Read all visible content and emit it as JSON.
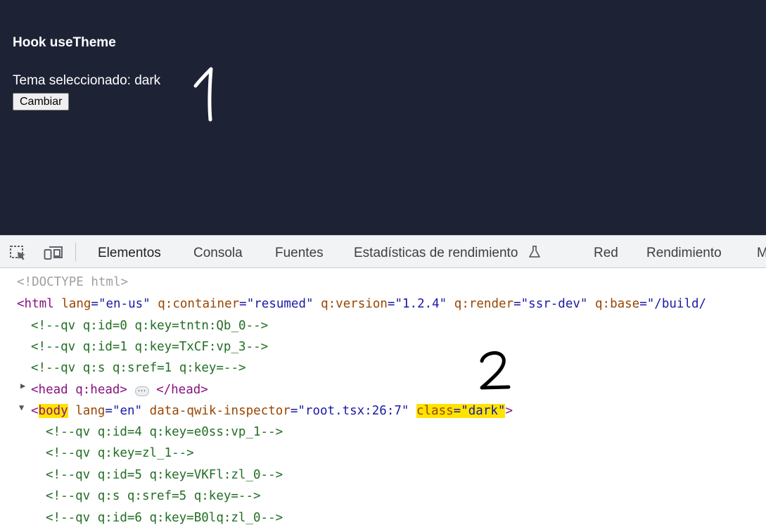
{
  "preview": {
    "heading": "Hook useTheme",
    "theme_line": "Tema seleccionado: dark",
    "button_label": "Cambiar"
  },
  "annotations": {
    "first": "1",
    "second": "2"
  },
  "toolbar": {
    "tabs": [
      {
        "label": "Elementos",
        "active": true
      },
      {
        "label": "Consola"
      },
      {
        "label": "Fuentes"
      },
      {
        "label": "Estadísticas de rendimiento",
        "icon": "flask-icon"
      },
      {
        "label": "Red"
      },
      {
        "label": "Rendimiento"
      },
      {
        "label": "M"
      }
    ],
    "icons": [
      "element-picker-icon",
      "device-toolbar-icon"
    ],
    "accent_color": "#1a73e8"
  },
  "elements_panel": {
    "doctype": "<!DOCTYPE html>",
    "html_open": {
      "tag": "html",
      "attrs": [
        {
          "name": "lang",
          "value": "\"en-us\""
        },
        {
          "name": "q:container",
          "value": "\"resumed\""
        },
        {
          "name": "q:version",
          "value": "\"1.2.4\""
        },
        {
          "name": "q:render",
          "value": "\"ssr-dev\""
        },
        {
          "name": "q:base",
          "value": "\"/build/"
        }
      ]
    },
    "html_comments": [
      "<!--qv q:id=0 q:key=tntn:Qb_0-->",
      "<!--qv q:id=1 q:key=TxCF:vp_3-->",
      "<!--qv q:s q:sref=1 q:key=-->"
    ],
    "head": {
      "open": "<head q:head>",
      "close": "</head>"
    },
    "body_open": {
      "tag": "body",
      "attrs": [
        {
          "name": "lang",
          "value": "\"en\""
        },
        {
          "name": "data-qwik-inspector",
          "value": "\"root.tsx:26:7\""
        }
      ],
      "class_attr": {
        "name": "class",
        "value": "\"dark\""
      }
    },
    "body_comments": [
      "<!--qv q:id=4 q:key=e0ss:vp_1-->",
      "<!--qv q:key=zl_1-->",
      "<!--qv q:id=5 q:key=VKFl:zl_0-->",
      "<!--qv q:s q:sref=5 q:key=-->",
      "<!--qv q:id=6 q:key=B0lq:zl_0-->"
    ],
    "highlight_color": "#ffe400"
  }
}
